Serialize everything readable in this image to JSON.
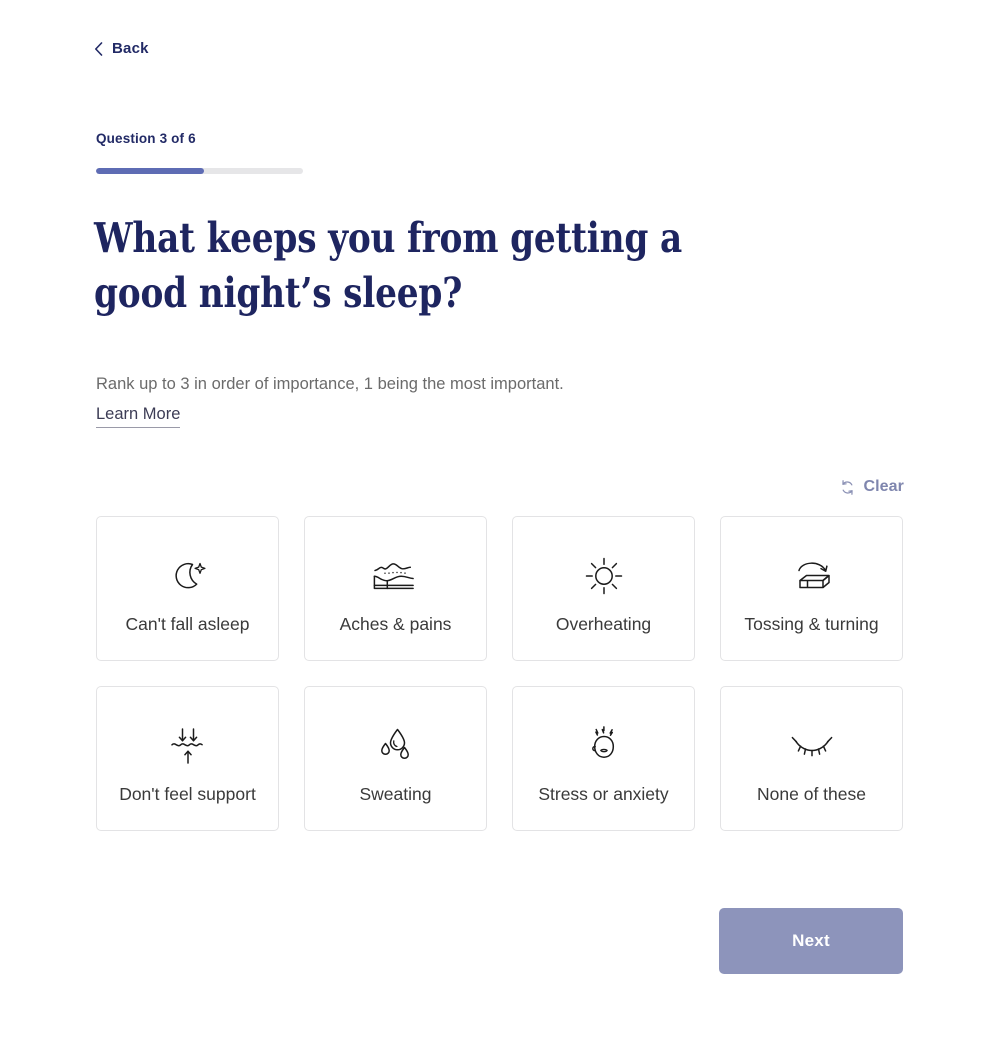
{
  "nav": {
    "back_label": "Back"
  },
  "progress": {
    "counter_label": "Question 3 of 6",
    "current": 3,
    "total": 6,
    "percent": 52,
    "fill_color": "#5e6cb4",
    "track_color": "#e6e6e8"
  },
  "question": {
    "title": "What keeps you from getting a good night’s sleep?",
    "instructions": "Rank up to 3 in order of importance, 1 being the most important.",
    "learn_more_label": "Learn More"
  },
  "toolbar": {
    "clear_label": "Clear",
    "clear_icon": "refresh-icon"
  },
  "options": [
    {
      "label": "Can't fall asleep",
      "icon": "moon-star-icon",
      "selected": false
    },
    {
      "label": "Aches & pains",
      "icon": "person-on-bed-icon",
      "selected": false
    },
    {
      "label": "Overheating",
      "icon": "sun-icon",
      "selected": false
    },
    {
      "label": "Tossing & turning",
      "icon": "mattress-arrow-icon",
      "selected": false
    },
    {
      "label": "Don't feel support",
      "icon": "arrows-wave-icon",
      "selected": false
    },
    {
      "label": "Sweating",
      "icon": "water-drops-icon",
      "selected": false
    },
    {
      "label": "Stress or anxiety",
      "icon": "stressed-head-icon",
      "selected": false
    },
    {
      "label": "None of these",
      "icon": "closed-eye-icon",
      "selected": false
    }
  ],
  "footer": {
    "next_label": "Next",
    "next_color": "#8d94bb",
    "next_disabled": true
  },
  "theme": {
    "navy": "#1e2560",
    "accent": "#5e6cb4",
    "muted_text": "#6b6b6b",
    "card_border": "#e3e3e5"
  }
}
